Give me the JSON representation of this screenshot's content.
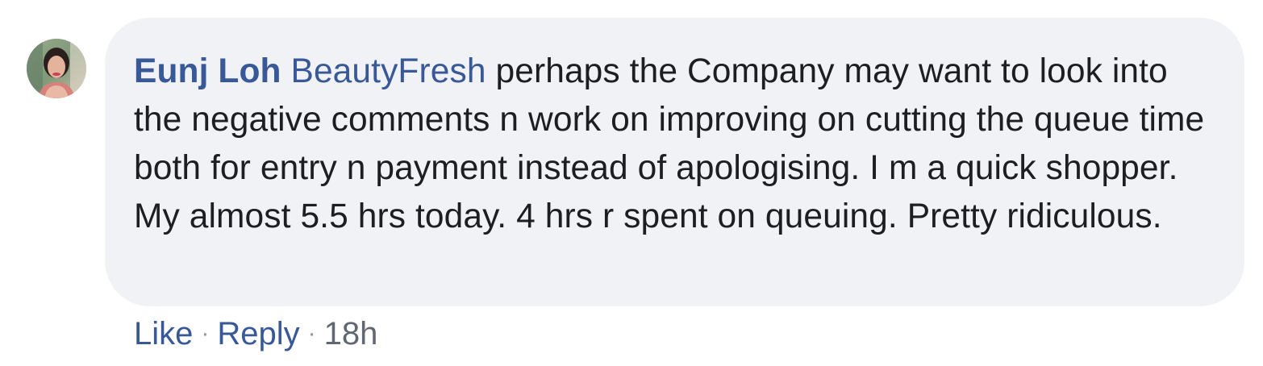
{
  "comment": {
    "author": {
      "name": "Eunj Loh",
      "avatar_icon": "profile-photo"
    },
    "mention": "BeautyFresh",
    "text": "perhaps the Company may want to look into the negative comments n work on improving on cutting the queue time both for entry n payment instead of apologising. I m a quick shopper. My almost 5.5 hrs today. 4 hrs r spent on queuing. Pretty ridiculous.",
    "actions": {
      "like_label": "Like",
      "reply_label": "Reply",
      "separator": "·",
      "timestamp": "18h"
    }
  },
  "colors": {
    "bubble_background": "#f0f2f5",
    "link_blue": "#385898",
    "body_text": "#1c1e21",
    "meta_gray": "#606770"
  }
}
